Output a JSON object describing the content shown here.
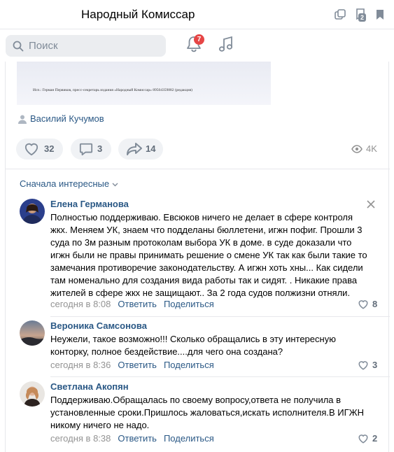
{
  "header": {
    "title": "Народный Комиссар",
    "icons": [
      "copy-icon",
      "bookmark-stack-icon",
      "bookmark-icon"
    ],
    "stack_count": "2"
  },
  "search": {
    "placeholder": "Поиск"
  },
  "notifications": {
    "count": "7"
  },
  "post": {
    "scan_caption": "Исп.: Герман Первиков, пресс-секретарь издания «Народный Комиссар» 89504359882 (редакция)",
    "author": "Василий Кучумов",
    "likes": "32",
    "comments": "3",
    "shares": "14",
    "views": "4K"
  },
  "comments_section": {
    "sort_label": "Сначала интересные",
    "reply_label": "Ответить",
    "share_label": "Поделиться",
    "items": [
      {
        "name": "Елена Германова",
        "text": "Полностью поддерживаю. Евсюков ничего не делает в сфере контроля жкх. Меняем УК, знаем что подделаны бюллетени, игжн пофиг. Прошли 3 суда по 3м разным протоколам выбора УК в доме. в суде доказали что игжн были не правы принимать решение о смене УК так как были такие то замечания противоречие законодательству. А игжн хоть хны... Как сидели там номенально для создания вида работы так и сидят. . Никакие права жителей в сфере жкх не защищают.. За 2 года судов полжизни отняли.",
        "time": "сегодня в 8:08",
        "likes": "8"
      },
      {
        "name": "Вероника Самсонова",
        "text": "Неужели, такое возможно!!! Сколько обращались в эту интересную конторку, полное бездействие....для чего она создана?",
        "time": "сегодня в 8:36",
        "likes": "3"
      },
      {
        "name": "Светлана Акопян",
        "text": "Поддерживаю.Обращалась по своему вопросу,ответа не получила в установленные сроки.Пришлось жаловаться,искать исполнителя.В ИГЖН никому ничего не надо.",
        "time": "сегодня в 8:38",
        "likes": "2"
      }
    ]
  },
  "colors": {
    "link": "#2a5885",
    "muted": "#939393",
    "badge": "#e64646",
    "chip_bg": "#f0f2f5",
    "search_bg": "#ebedf0"
  }
}
